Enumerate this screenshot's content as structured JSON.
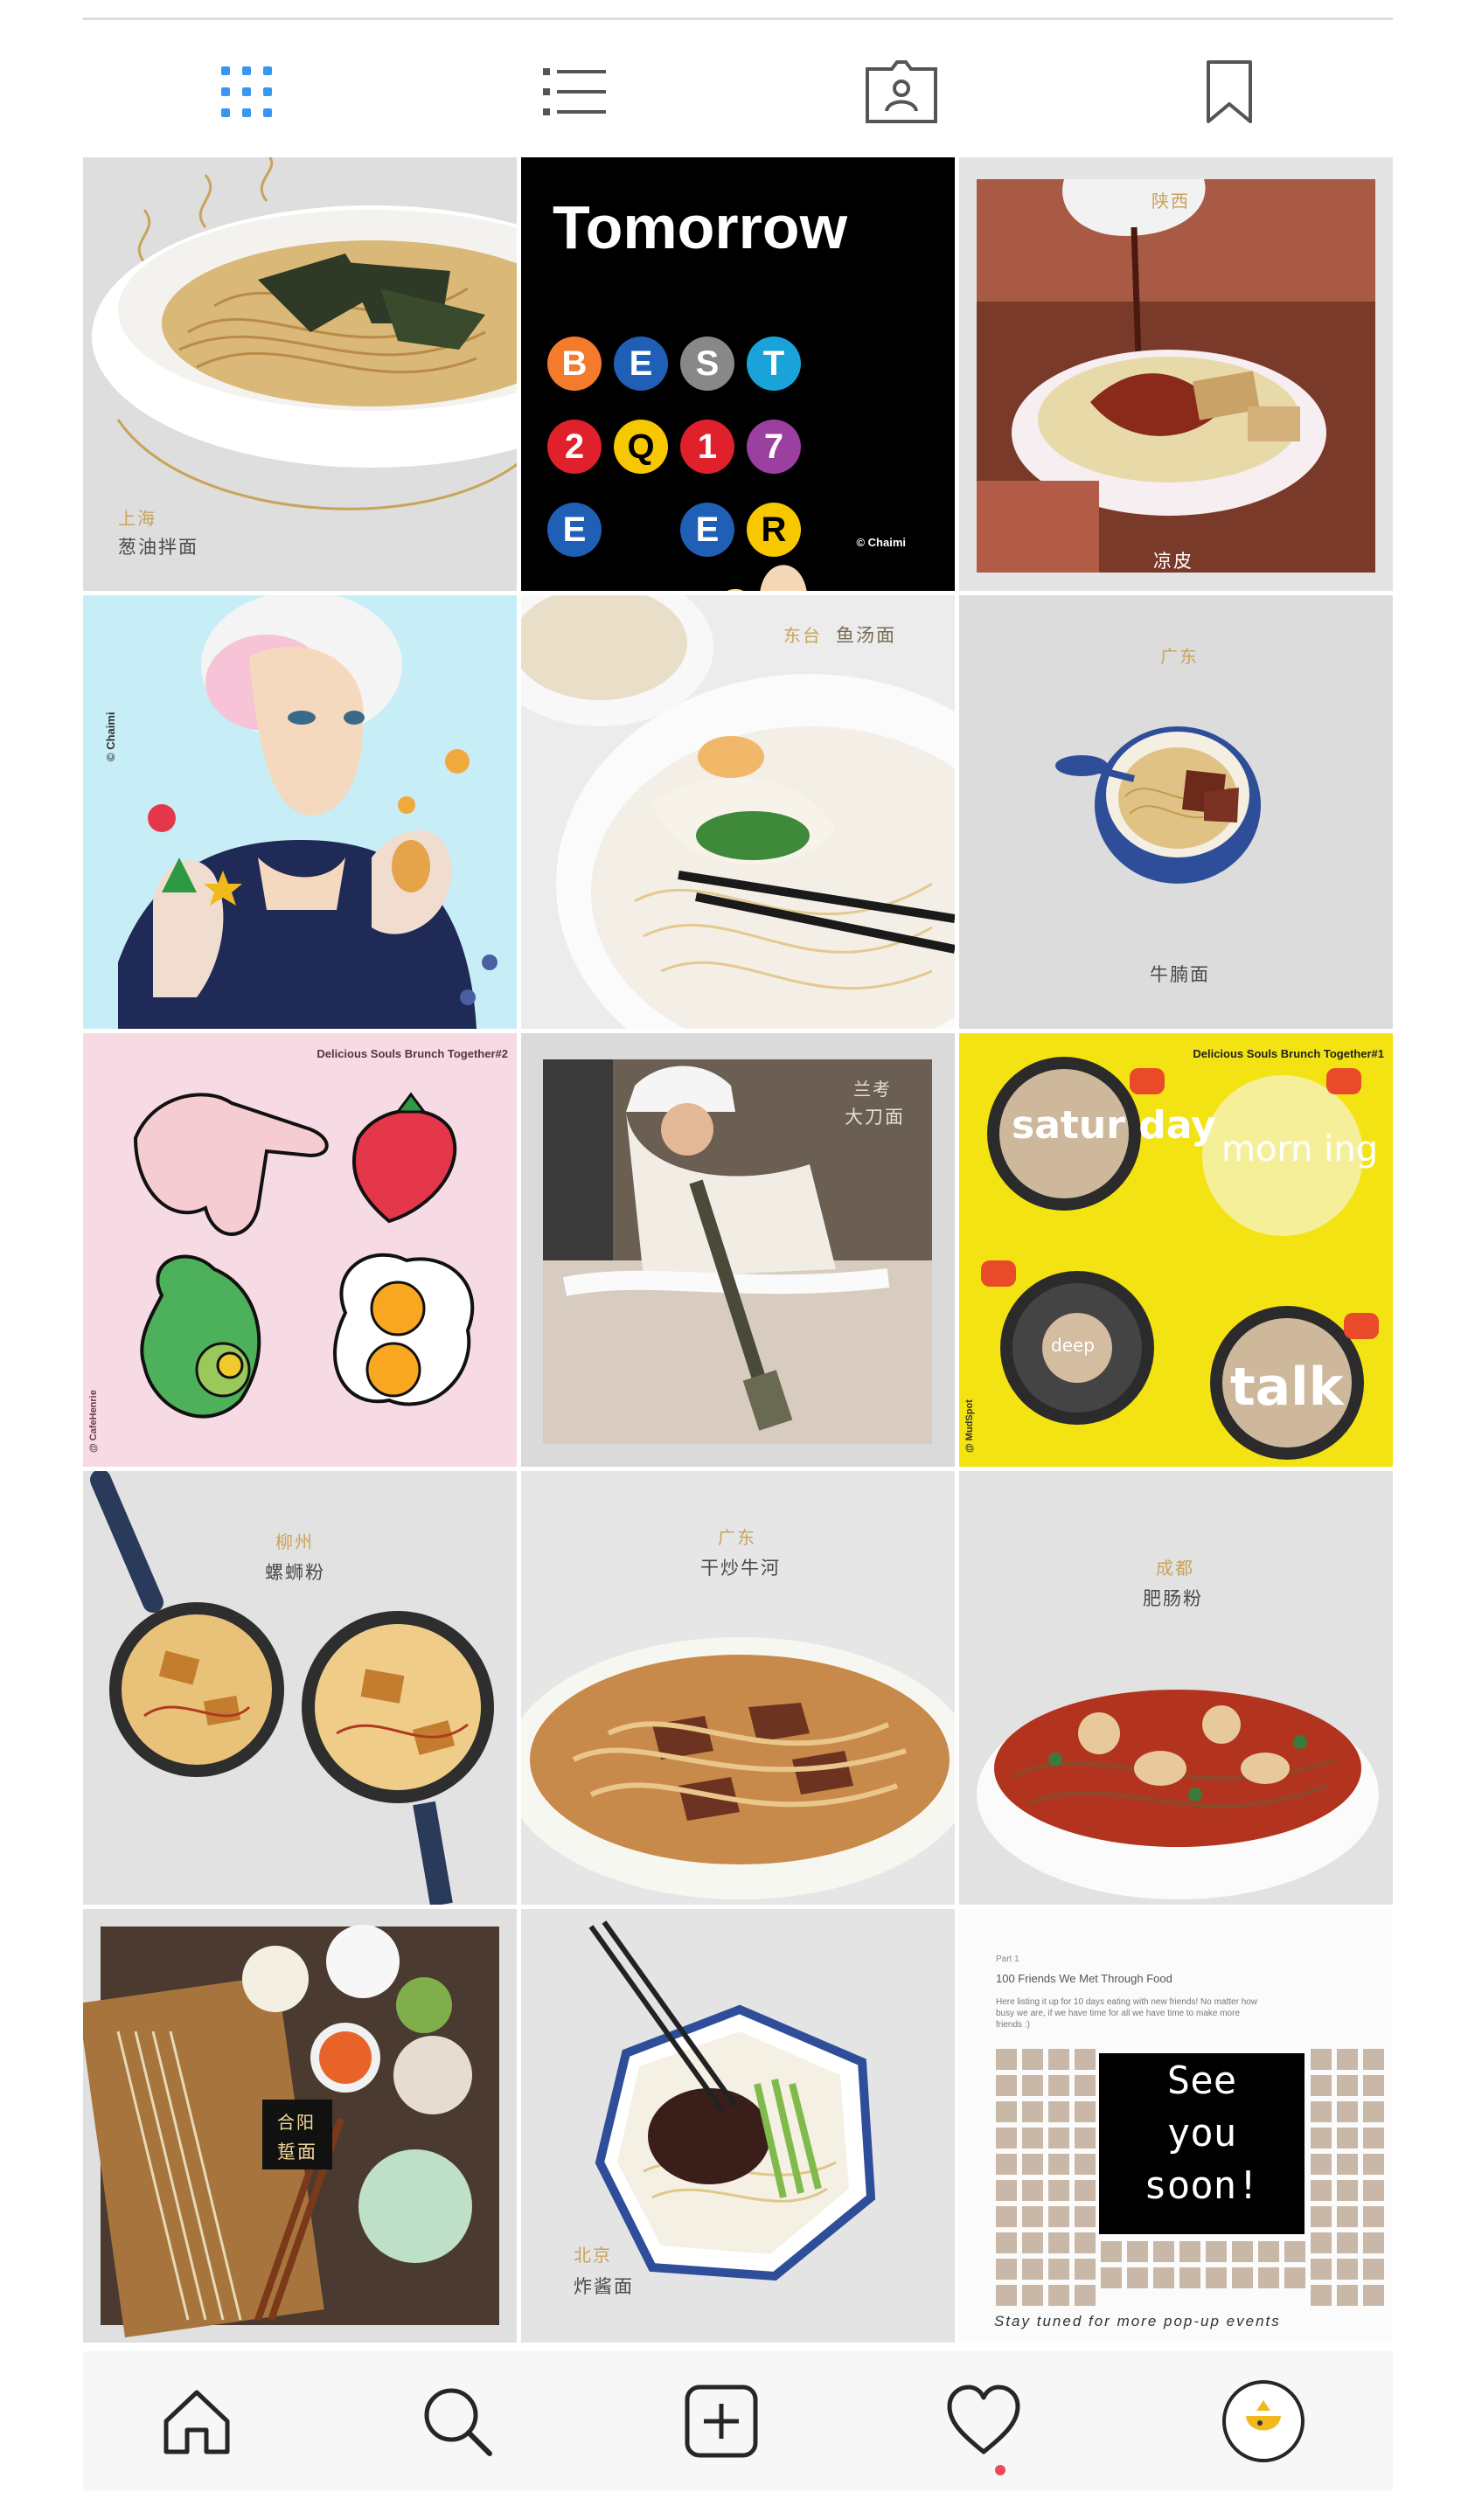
{
  "view_tabs": {
    "grid_icon": "grid-icon",
    "list_icon": "list-icon",
    "tagged_icon": "tagged-user-icon",
    "saved_icon": "bookmark-icon",
    "active_color": "#3897f0"
  },
  "posts": [
    {
      "region": "上海",
      "dish": "葱油拌面"
    },
    {
      "title": "Tomorrow",
      "badges_row1": [
        "B",
        "E",
        "S",
        "T"
      ],
      "badges_row2": [
        "2",
        "Q",
        "1",
        "7"
      ],
      "badges_row3": [
        "E",
        "",
        "E",
        "R"
      ],
      "credit": "© Chaimi"
    },
    {
      "region": "陕西",
      "dish": "凉皮"
    },
    {
      "credit": "© Chaimi"
    },
    {
      "region": "东台",
      "dish": "鱼汤面"
    },
    {
      "region": "广东",
      "dish": "牛腩面"
    },
    {
      "title": "Delicious Souls Brunch Together#2",
      "credit": "@ CafeHenrie"
    },
    {
      "region": "兰考",
      "dish": "大刀面"
    },
    {
      "title": "Delicious Souls Brunch Together#1",
      "credit": "@ MudSpot",
      "words": [
        "satur day",
        "morn ing",
        "deep",
        "talk"
      ]
    },
    {
      "region": "柳州",
      "dish": "螺蛳粉"
    },
    {
      "region": "广东",
      "dish": "干炒牛河"
    },
    {
      "region": "成都",
      "dish": "肥肠粉"
    },
    {
      "region": "合阳",
      "dish": "踅面"
    },
    {
      "region": "北京",
      "dish": "炸酱面"
    },
    {
      "kicker": "Part 1",
      "title": "100 Friends We Met Through Food",
      "note": "Here listing it up for 10 days eating with new friends! No matter how busy we are, if we have time for all we have time to make more friends :)",
      "box_lines": [
        "See",
        "you",
        "soon!"
      ],
      "footer": "Stay tuned for more pop-up events"
    }
  ],
  "bottom_nav": {
    "home_icon": "home-icon",
    "search_icon": "search-icon",
    "add_icon": "add-post-icon",
    "activity_icon": "heart-icon",
    "profile_icon": "profile-avatar",
    "notification_color": "#ed4956"
  }
}
